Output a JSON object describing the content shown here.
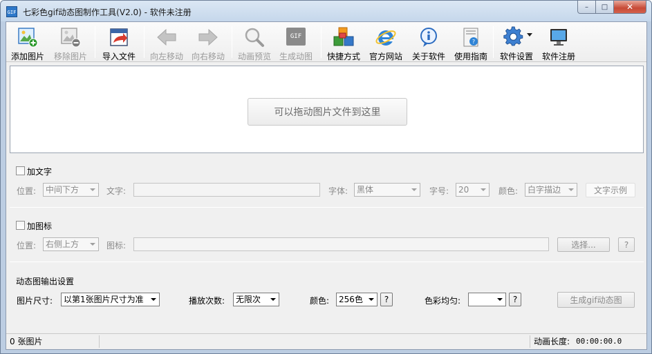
{
  "window": {
    "app_icon_text": "GIF",
    "title": "七彩色gif动态图制作工具(V2.0) - 软件未注册",
    "close_glyph": "✕",
    "max_glyph": "□",
    "min_glyph": "–"
  },
  "toolbar": {
    "add_image": "添加图片",
    "remove_image": "移除图片",
    "import_file": "导入文件",
    "move_left": "向左移动",
    "move_right": "向右移动",
    "preview": "动画预览",
    "generate": "生成动图",
    "gif_badge": "GIF",
    "shortcut": "快捷方式",
    "website": "官方网站",
    "about": "关于软件",
    "guide": "使用指南",
    "settings": "软件设置",
    "register": "软件注册"
  },
  "drop_area": {
    "hint": "可以拖动图片文件到这里"
  },
  "text_section": {
    "checkbox_label": "加文字",
    "position_label": "位置:",
    "position_value": "中间下方",
    "text_label": "文字:",
    "font_label": "字体:",
    "font_value": "黑体",
    "size_label": "字号:",
    "size_value": "20",
    "color_label": "颜色:",
    "color_value": "白字描边",
    "sample_button": "文字示例"
  },
  "icon_section": {
    "checkbox_label": "加图标",
    "position_label": "位置:",
    "position_value": "右侧上方",
    "icon_label": "图标:",
    "browse_button": "选择...",
    "help_button": "?"
  },
  "output_section": {
    "title": "动态图输出设置",
    "size_label": "图片尺寸:",
    "size_value": "以第1张图片尺寸为准",
    "loop_label": "播放次数:",
    "loop_value": "无限次",
    "color_label": "颜色:",
    "color_value": "256色",
    "color_help": "?",
    "dither_label": "色彩均匀:",
    "dither_value": "",
    "dither_help": "?",
    "generate_button": "生成gif动态图"
  },
  "status": {
    "image_count": "0 张图片",
    "duration_label": "动画长度:",
    "duration_value": "00:00:00.0"
  },
  "colors": {
    "accent_blue": "#2e78c9",
    "frame": "#bccde2",
    "client_bg": "#f0f0f0",
    "disabled_text": "#8a8a8a"
  }
}
